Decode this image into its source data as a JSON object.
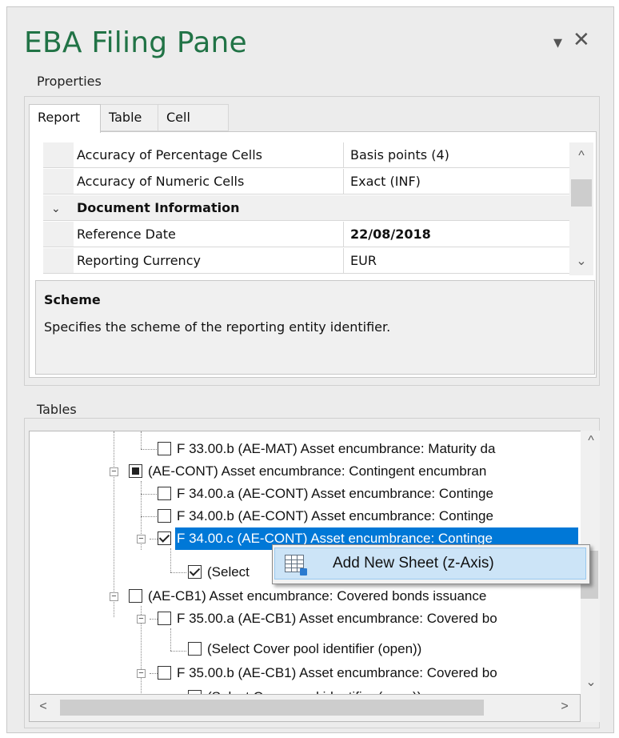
{
  "pane": {
    "title": "EBA Filing Pane",
    "dropdown_glyph": "▾",
    "close_glyph": "✕"
  },
  "properties": {
    "section_label": "Properties",
    "tabs": [
      {
        "label": "Report",
        "active": true
      },
      {
        "label": "Table",
        "active": false
      },
      {
        "label": "Cell",
        "active": false
      }
    ],
    "rows": [
      {
        "name": "Accuracy of Percentage Cells",
        "value": "Basis points (4)"
      },
      {
        "name": "Accuracy of Numeric Cells",
        "value": "Exact (INF)"
      },
      {
        "category": "Document Information",
        "collapse_glyph": "⌄"
      },
      {
        "name": "Reference Date",
        "value": "22/08/2018",
        "bold": true
      },
      {
        "name": "Reporting Currency",
        "value": "EUR"
      }
    ],
    "scroll_up": "^",
    "scroll_down": "⌄",
    "description": {
      "title": "Scheme",
      "text": "Specifies the scheme of the reporting entity identifier."
    }
  },
  "tables": {
    "section_label": "Tables",
    "nodes": [
      {
        "label": "F 33.00.b (AE-MAT) Asset encumbrance: Maturity da",
        "state": "unchecked"
      },
      {
        "label": "(AE-CONT) Asset encumbrance: Contingent encumbran",
        "state": "partial",
        "expander": "−"
      },
      {
        "label": "F 34.00.a (AE-CONT) Asset encumbrance: Continge",
        "state": "unchecked"
      },
      {
        "label": "F 34.00.b (AE-CONT) Asset encumbrance: Continge",
        "state": "unchecked"
      },
      {
        "label": "F 34.00.c (AE-CONT) Asset encumbrance: Continge",
        "state": "checked",
        "expander": "−",
        "selected": true
      },
      {
        "label": "(Select",
        "state": "checked"
      },
      {
        "label": "(AE-CB1) Asset encumbrance: Covered bonds issuance",
        "state": "unchecked",
        "expander": "−"
      },
      {
        "label": "F 35.00.a (AE-CB1) Asset encumbrance: Covered bo",
        "state": "unchecked",
        "expander": "−"
      },
      {
        "label": "(Select Cover pool identifier (open))",
        "state": "unchecked"
      },
      {
        "label": "F 35.00.b (AE-CB1) Asset encumbrance: Covered bo",
        "state": "unchecked",
        "expander": "−"
      },
      {
        "label": "(Select Cover pool identifier (open))",
        "state": "unchecked"
      }
    ],
    "scroll_left": "<",
    "scroll_right": ">",
    "scroll_up": "^",
    "scroll_down": "⌄"
  },
  "context_menu": {
    "items": [
      {
        "label": "Add New Sheet (z-Axis)",
        "icon": "add-sheet-icon"
      }
    ]
  }
}
